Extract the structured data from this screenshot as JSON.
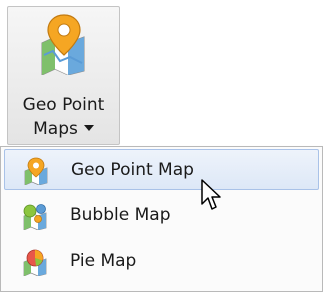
{
  "ribbon_button": {
    "icon": "geo-point-map-icon",
    "label_line1": "Geo Point",
    "label_line2": "Maps"
  },
  "menu": {
    "items": [
      {
        "label": "Geo Point Map",
        "icon": "geo-point-map-icon",
        "highlighted": true
      },
      {
        "label": "Bubble Map",
        "icon": "bubble-map-icon",
        "highlighted": false
      },
      {
        "label": "Pie Map",
        "icon": "pie-map-icon",
        "highlighted": false
      }
    ]
  },
  "colors": {
    "highlight_border": "#a9c2e8",
    "highlight_fill": "#dde8f7",
    "pin_orange": "#f5a623",
    "map_green": "#4caf50",
    "map_blue": "#5b9bd5"
  }
}
